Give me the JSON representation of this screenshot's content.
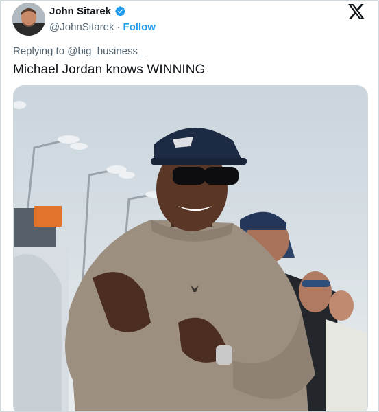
{
  "author": {
    "name": "John Sitarek",
    "handle": "@JohnSitarek",
    "separator": "·",
    "follow_label": "Follow",
    "verified": true,
    "verified_color": "#1d9bf0"
  },
  "brand_icon": "x-logo-icon",
  "reply": {
    "prefix": "Replying to",
    "mention": "@big_business_"
  },
  "tweet": {
    "text": "Michael Jordan knows WINNING"
  },
  "media": {
    "photo_icon": "photo"
  },
  "colors": {
    "text": "#0f1419",
    "secondary": "#536471",
    "link": "#1d9bf0",
    "border": "#cfd9de"
  }
}
